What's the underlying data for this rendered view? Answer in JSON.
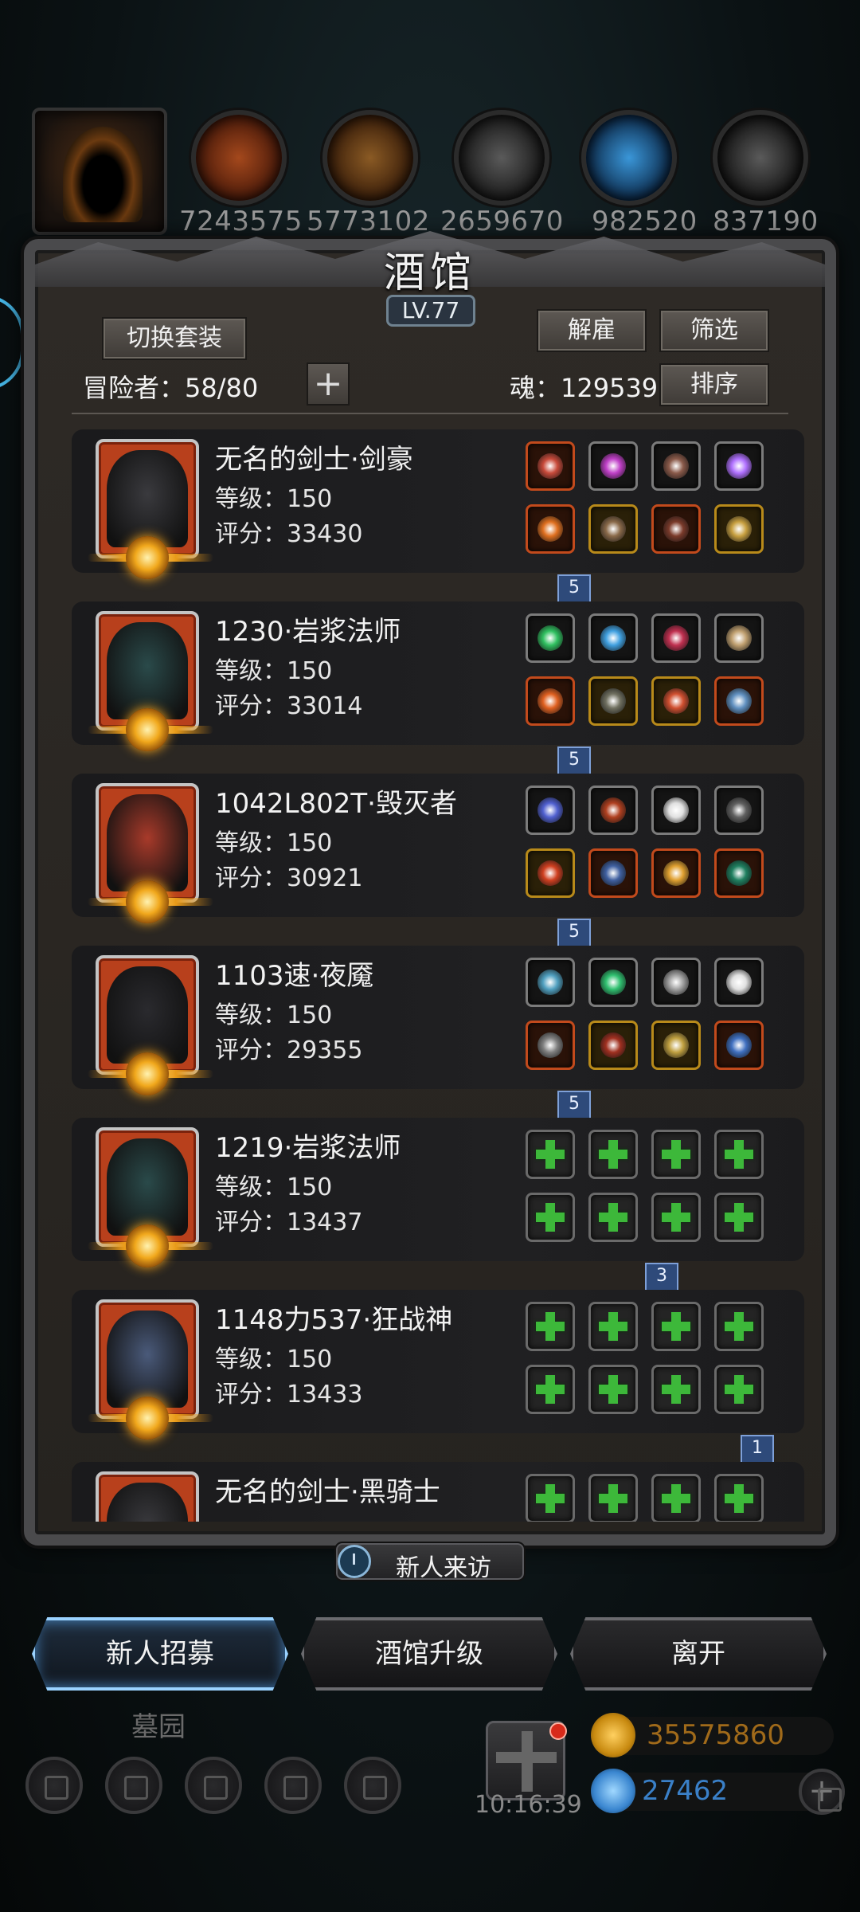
{
  "resources": [
    {
      "icon": "hood-portrait-icon"
    },
    {
      "icon": "meat-icon",
      "value": "7243575",
      "color": "#b34a1c"
    },
    {
      "icon": "wood-icon",
      "value": "5773102",
      "color": "#9a6a2c"
    },
    {
      "icon": "stone-icon",
      "value": "2659670",
      "color": "#5a5a5a"
    },
    {
      "icon": "crystal-icon",
      "value": "982520",
      "color": "#2a86c8"
    },
    {
      "icon": "iron-icon",
      "value": "837190",
      "color": "#6a6a6a"
    }
  ],
  "tavern": {
    "title": "酒馆",
    "level": "LV.77",
    "switch_outfit": "切换套装",
    "dismiss": "解雇",
    "filter": "筛选",
    "sort": "排序",
    "adventurers_label": "冒险者：58/80",
    "soul_label": "魂：129539",
    "plus": "+"
  },
  "heroes": [
    {
      "name": "无名的剑士·剑豪",
      "level": "等级：150",
      "score": "评分：33430",
      "face": "#3a3a3e",
      "ribbon": "5",
      "equip": [
        {
          "c": "red",
          "g": "#c84a3a"
        },
        {
          "c": "",
          "g": "#c040c8"
        },
        {
          "c": "",
          "g": "#8a5a4a"
        },
        {
          "c": "",
          "g": "#b070ff"
        },
        {
          "c": "red",
          "g": "#e07020"
        },
        {
          "c": "gold",
          "g": "#8a6a4a"
        },
        {
          "c": "red",
          "g": "#7a3a2a"
        },
        {
          "c": "gold",
          "g": "#c8a040"
        }
      ]
    },
    {
      "name": "1230·岩浆法师",
      "level": "等级：150",
      "score": "评分：33014",
      "face": "#2a4a4a",
      "ribbon": "5",
      "equip": [
        {
          "c": "",
          "g": "#30c060"
        },
        {
          "c": "",
          "g": "#40a0e0"
        },
        {
          "c": "",
          "g": "#c03050"
        },
        {
          "c": "",
          "g": "#c0a070"
        },
        {
          "c": "red",
          "g": "#e06020"
        },
        {
          "c": "gold",
          "g": "#707060"
        },
        {
          "c": "gold",
          "g": "#d05030"
        },
        {
          "c": "red",
          "g": "#6090c0"
        }
      ]
    },
    {
      "name": "1042L802T·毁灭者",
      "level": "等级：150",
      "score": "评分：30921",
      "face": "#a83a2a",
      "ribbon": "5",
      "equip": [
        {
          "c": "",
          "g": "#5060d0"
        },
        {
          "c": "",
          "g": "#b04020"
        },
        {
          "c": "",
          "g": "#e0e0e0"
        },
        {
          "c": "",
          "g": "#606060"
        },
        {
          "c": "gold",
          "g": "#d04020"
        },
        {
          "c": "red",
          "g": "#4060a0"
        },
        {
          "c": "red",
          "g": "#e0a030"
        },
        {
          "c": "red",
          "g": "#208060"
        }
      ]
    },
    {
      "name": "1103速·夜魇",
      "level": "等级：150",
      "score": "评分：29355",
      "face": "#2a2a2e",
      "ribbon": "5",
      "equip": [
        {
          "c": "",
          "g": "#50a0c0"
        },
        {
          "c": "",
          "g": "#30c070"
        },
        {
          "c": "",
          "g": "#a0a0a0"
        },
        {
          "c": "",
          "g": "#e0e0e0"
        },
        {
          "c": "red",
          "g": "#808080"
        },
        {
          "c": "gold",
          "g": "#a03020"
        },
        {
          "c": "gold",
          "g": "#c0a040"
        },
        {
          "c": "red",
          "g": "#4070c0"
        }
      ]
    },
    {
      "name": "1219·岩浆法师",
      "level": "等级：150",
      "score": "评分：13437",
      "face": "#2a4a4a",
      "ribbon": "3",
      "empty": true
    },
    {
      "name": "1148力537·狂战神",
      "level": "等级：150",
      "score": "评分：13433",
      "face": "#4a5a7a",
      "ribbon": "1",
      "empty": true
    },
    {
      "name": "无名的剑士·黑骑士",
      "level": "",
      "score": "",
      "face": "#3a3a3e",
      "empty": true
    }
  ],
  "visitor_button": "新人来访",
  "actions": {
    "recruit": "新人招募",
    "upgrade": "酒馆升级",
    "leave": "离开"
  },
  "footer": {
    "area_name": "墓园",
    "timer": "10:16:39",
    "gold": "35575860",
    "gems": "27462",
    "add": "+"
  },
  "colors": {
    "accent_blue": "#9ad2ff",
    "gold_text": "#e0a030",
    "gem_text": "#4aa0f0"
  }
}
